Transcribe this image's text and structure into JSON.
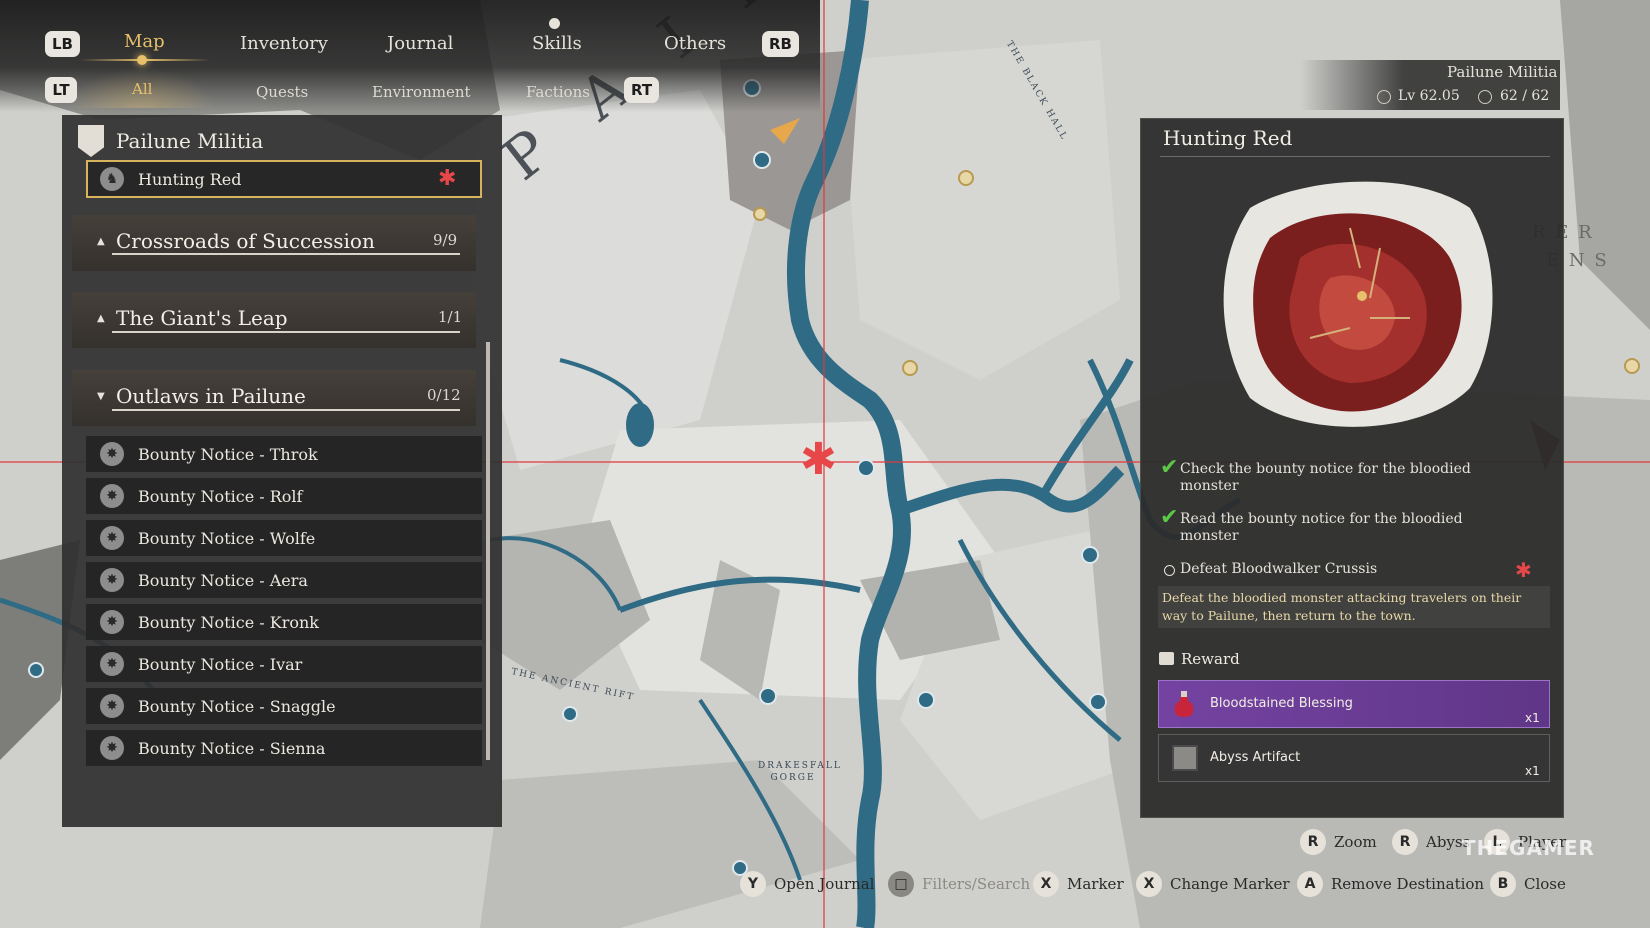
{
  "top_tabs": {
    "left_bumper": "LB",
    "right_bumper": "RB",
    "items": [
      {
        "label": "Map",
        "active": true
      },
      {
        "label": "Inventory",
        "active": false
      },
      {
        "label": "Journal",
        "active": false
      },
      {
        "label": "Skills",
        "active": false
      },
      {
        "label": "Others",
        "active": false
      }
    ]
  },
  "sub_tabs": {
    "left_trigger": "LT",
    "right_trigger": "RT",
    "items": [
      {
        "label": "All",
        "active": true
      },
      {
        "label": "Quests",
        "active": false
      },
      {
        "label": "Environment",
        "active": false
      },
      {
        "label": "Factions",
        "active": false
      }
    ]
  },
  "quest_list": {
    "faction_title": "Pailune Militia",
    "selected_quest": "Hunting Red",
    "groups": [
      {
        "title": "Crossroads of Succession",
        "count": "9/9",
        "expanded": false
      },
      {
        "title": "The Giant's Leap",
        "count": "1/1",
        "expanded": false
      },
      {
        "title": "Outlaws in Pailune",
        "count": "0/12",
        "expanded": true
      }
    ],
    "bounties": [
      "Bounty Notice - Throk",
      "Bounty Notice - Rolf",
      "Bounty Notice - Wolfe",
      "Bounty Notice - Aera",
      "Bounty Notice - Kronk",
      "Bounty Notice - Ivar",
      "Bounty Notice - Snaggle",
      "Bounty Notice - Sienna"
    ]
  },
  "player_info": {
    "faction": "Pailune Militia",
    "level": "Lv 62.05",
    "progress": "62 / 62"
  },
  "quest_detail": {
    "title": "Hunting Red",
    "objectives": [
      {
        "text": "Check the bounty notice for the bloodied monster",
        "done": true
      },
      {
        "text": "Read the bounty notice for the bloodied monster",
        "done": true
      },
      {
        "text": "Defeat Bloodwalker Crussis",
        "done": false
      }
    ],
    "description": "Defeat the bloodied monster attacking travelers on their way to Pailune, then return to the town.",
    "reward_title": "Reward",
    "rewards": [
      {
        "name": "Bloodstained Blessing",
        "qty": "x1",
        "rarity": "epic"
      },
      {
        "name": "Abyss Artifact",
        "qty": "x1",
        "rarity": "normal"
      }
    ]
  },
  "map_labels": {
    "river_left": "THE ANCIENT RIFT",
    "gorge": "DRAKESFALL GORGE",
    "black_hall": "THE BLACK HALL",
    "right_region_1": "R E R",
    "right_region_2": "E N S",
    "region_big": "P A I L U"
  },
  "bottom_prompts": {
    "row1": [
      {
        "key": "R",
        "label": "Zoom"
      },
      {
        "key": "R",
        "label": "Abyss"
      },
      {
        "key": "L",
        "label": "Player"
      }
    ],
    "row2": [
      {
        "key": "Y",
        "label": "Open Journal",
        "dim": false
      },
      {
        "key": "□",
        "label": "Filters/Search",
        "dim": true
      },
      {
        "key": "X",
        "label": "Marker",
        "dim": false
      },
      {
        "key": "X",
        "label": "Change Marker",
        "dim": false
      },
      {
        "key": "A",
        "label": "Remove Destination",
        "dim": false
      },
      {
        "key": "B",
        "label": "Close",
        "dim": false
      }
    ]
  },
  "watermark": "THEGAMER",
  "colors": {
    "accent_gold": "#e6c06a",
    "water": "#2f6b84",
    "marker_red": "#e8474a",
    "check_green": "#5cc846",
    "epic_purple": "#7844a8"
  }
}
